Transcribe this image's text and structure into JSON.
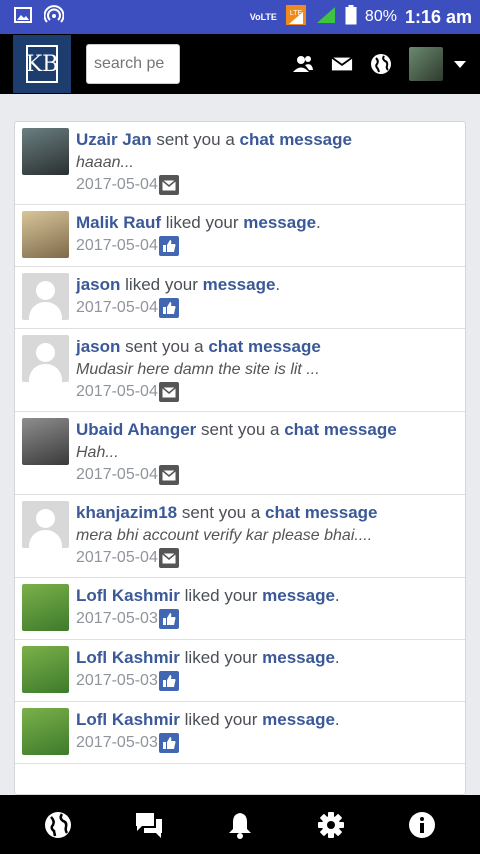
{
  "status_bar": {
    "volte": "VoLTE",
    "lte": "LTE",
    "battery": "80%",
    "time": "1:16 am"
  },
  "header": {
    "logo_text": "KB",
    "search_placeholder": "search pe"
  },
  "notifications": [
    {
      "name": "Uzair Jan",
      "action": "sent you a",
      "object": "chat message",
      "suffix": "",
      "preview": "haaan...",
      "date": "2017-05-04",
      "type": "mail"
    },
    {
      "name": "Malik Rauf",
      "action": "liked your",
      "object": "message",
      "suffix": ".",
      "preview": "",
      "date": "2017-05-04",
      "type": "like"
    },
    {
      "name": "jason",
      "action": "liked your",
      "object": "message",
      "suffix": ".",
      "preview": "",
      "date": "2017-05-04",
      "type": "like"
    },
    {
      "name": "jason",
      "action": "sent you a",
      "object": "chat message",
      "suffix": "",
      "preview": "Mudasir here damn the site is lit ...",
      "date": "2017-05-04",
      "type": "mail"
    },
    {
      "name": "Ubaid Ahanger",
      "action": "sent you a",
      "object": "chat message",
      "suffix": "",
      "preview": "Hah...",
      "date": "2017-05-04",
      "type": "mail"
    },
    {
      "name": "khanjazim18",
      "action": "sent you a",
      "object": "chat message",
      "suffix": "",
      "preview": "mera bhi account verify kar please bhai....",
      "date": "2017-05-04",
      "type": "mail"
    },
    {
      "name": "Lofl Kashmir",
      "action": "liked your",
      "object": "message",
      "suffix": ".",
      "preview": "",
      "date": "2017-05-03",
      "type": "like"
    },
    {
      "name": "Lofl Kashmir",
      "action": "liked your",
      "object": "message",
      "suffix": ".",
      "preview": "",
      "date": "2017-05-03",
      "type": "like"
    },
    {
      "name": "Lofl Kashmir",
      "action": "liked your",
      "object": "message",
      "suffix": ".",
      "preview": "",
      "date": "2017-05-03",
      "type": "like"
    }
  ],
  "colors": {
    "status_bar": "#3d4fbf",
    "topbar": "#000000",
    "link": "#3b5998",
    "like_badge": "#4267b2",
    "mail_badge": "#555555"
  },
  "bottom_nav": [
    "globe-icon",
    "chat-icon",
    "bell-icon",
    "gear-icon",
    "info-icon"
  ]
}
